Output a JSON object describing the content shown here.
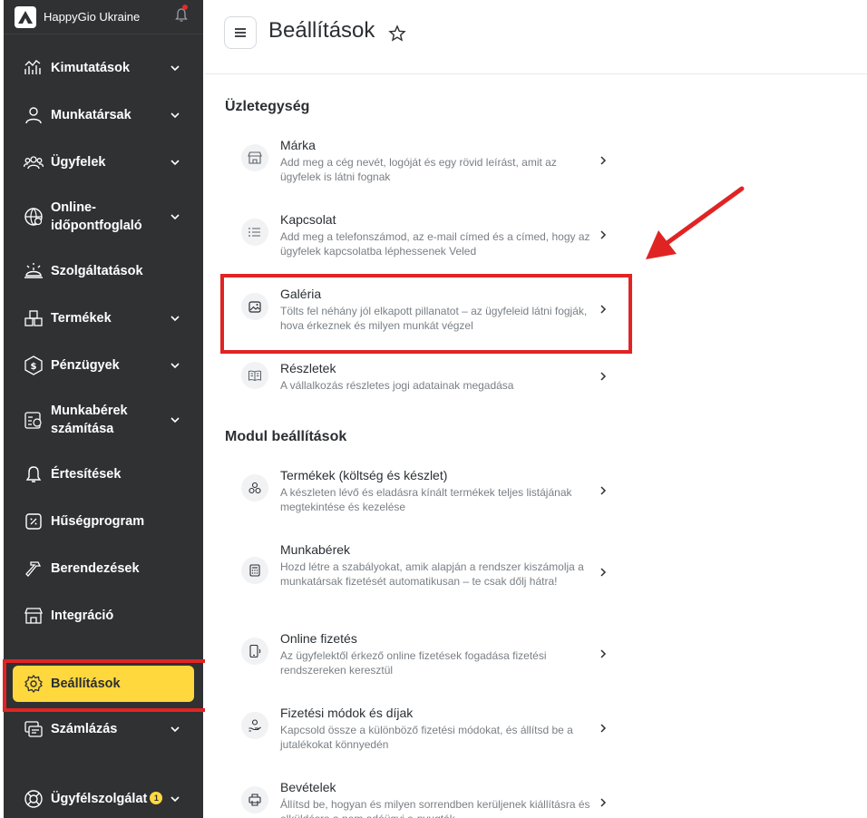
{
  "sidebar": {
    "brand": "HappyGio Ukraine",
    "items": [
      {
        "label": "Kimutatások",
        "icon": "stats-icon"
      },
      {
        "label": "Munkatársak",
        "icon": "user-icon"
      },
      {
        "label": "Ügyfelek",
        "icon": "users-icon"
      },
      {
        "label": "Online-időpontfoglaló",
        "line1": "Online-",
        "line2": "időpontfoglaló",
        "icon": "globe-icon"
      },
      {
        "label": "Szolgáltatások",
        "icon": "bell-service-icon"
      },
      {
        "label": "Termékek",
        "icon": "boxes-icon"
      },
      {
        "label": "Pénzügyek",
        "icon": "dollar-icon"
      },
      {
        "label": "Munkabérek számítása",
        "line1": "Munkabérek",
        "line2": "számítása",
        "icon": "payroll-icon"
      },
      {
        "label": "Értesítések",
        "icon": "notification-icon"
      },
      {
        "label": "Hűségprogram",
        "icon": "percent-icon"
      },
      {
        "label": "Berendezések",
        "icon": "hammer-icon"
      },
      {
        "label": "Integráció",
        "icon": "store-icon"
      },
      {
        "label": "Beállítások",
        "icon": "gear-icon"
      },
      {
        "label": "Számlázás",
        "icon": "billing-icon"
      },
      {
        "label": "Ügyfélszolgálat",
        "icon": "lifebuoy-icon",
        "badge": "1"
      }
    ]
  },
  "header": {
    "title": "Beállítások"
  },
  "sections": [
    {
      "title": "Üzletegység",
      "items": [
        {
          "title": "Márka",
          "desc": "Add meg a cég nevét, logóját és egy rövid leírást, amit az ügyfelek is látni fognak",
          "icon": "shop-icon"
        },
        {
          "title": "Kapcsolat",
          "desc": "Add meg a telefonszámod, az e-mail címed és a címed, hogy az ügyfelek kapcsolatba léphessenek Veled",
          "icon": "list-icon"
        },
        {
          "title": "Galéria",
          "desc": "Tölts fel néhány jól elkapott pillanatot – az ügyfeleid látni fogják, hova érkeznek és milyen munkát végzel",
          "icon": "image-icon"
        },
        {
          "title": "Részletek",
          "desc": "A vállalkozás részletes jogi adatainak megadása",
          "icon": "book-icon"
        }
      ]
    },
    {
      "title": "Modul beállítások",
      "items": [
        {
          "title": "Termékek (költség és készlet)",
          "desc": "A készleten lévő és eladásra kínált termékek teljes listájának megtekintése és kezelése",
          "icon": "cubes-icon"
        },
        {
          "title": "Munkabérek",
          "desc": "Hozd létre a szabályokat, amik alapján a rendszer kiszámolja a munkatársak fizetését automatikusan – te csak dőlj hátra!",
          "icon": "calculator-icon"
        },
        {
          "title": "Online fizetés",
          "desc": "Az ügyfelektől érkező online fizetések fogadása fizetési rendszereken keresztül",
          "icon": "phone-pay-icon"
        },
        {
          "title": "Fizetési módok és díjak",
          "desc": "Kapcsold össze a különböző fizetési módokat, és állítsd be a jutalékokat könnyedén",
          "icon": "hand-coin-icon"
        },
        {
          "title": "Bevételek",
          "desc": "Állítsd be, hogyan és milyen sorrendben kerüljenek kiállításra és elküldésre a nem adóügyi e-nyugták",
          "icon": "printer-icon"
        }
      ]
    }
  ],
  "colors": {
    "sidebar_bg": "#2f3133",
    "active_bg": "#ffd83d",
    "highlight": "#e02424"
  }
}
